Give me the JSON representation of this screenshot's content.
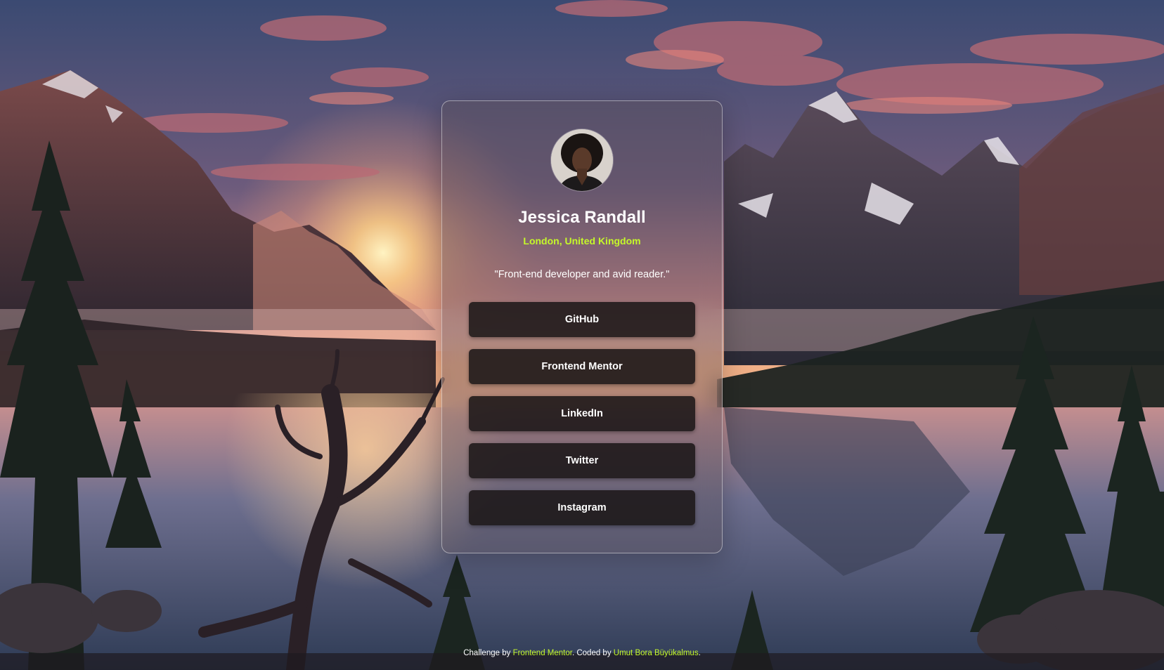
{
  "profile": {
    "name": "Jessica Randall",
    "location": "London, United Kingdom",
    "bio": "\"Front-end developer and avid reader.\"",
    "avatar_icon": "person-portrait-icon"
  },
  "links": [
    {
      "label": "GitHub"
    },
    {
      "label": "Frontend Mentor"
    },
    {
      "label": "LinkedIn"
    },
    {
      "label": "Twitter"
    },
    {
      "label": "Instagram"
    }
  ],
  "footer": {
    "prefix": "Challenge by",
    "challenge_link": "Frontend Mentor",
    "middle": ". Coded by",
    "author_link": "Umut Bora Büyükalmus",
    "suffix": "."
  },
  "colors": {
    "accent": "#c5f82a",
    "button_bg": "#1c1818",
    "text": "#ffffff"
  }
}
